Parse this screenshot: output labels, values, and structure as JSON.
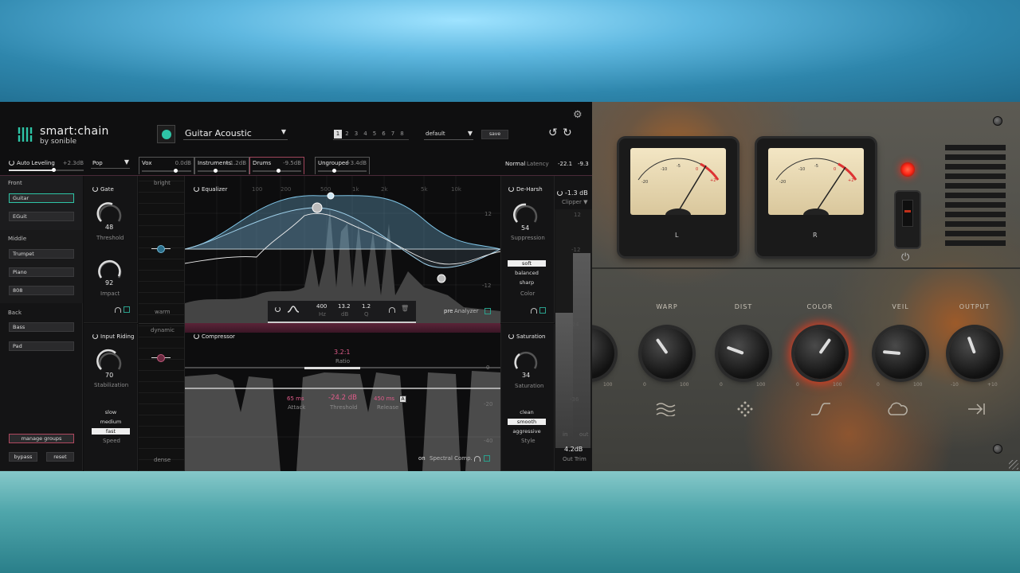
{
  "app": {
    "brand": "smart:chain",
    "byline": "by sonible"
  },
  "preset": {
    "name": "Guitar Acoustic",
    "slots": [
      "1",
      "2",
      "3",
      "4",
      "5",
      "6",
      "7",
      "8"
    ],
    "active_slot": "1",
    "bank": "default",
    "save_label": "save"
  },
  "topbar": {
    "auto_leveling_label": "Auto Leveling",
    "auto_leveling_value": "+2.3dB",
    "genre": "Pop",
    "groups": [
      {
        "name": "Vox",
        "value": "0.0dB"
      },
      {
        "name": "Instruments",
        "value": "+1.2dB"
      },
      {
        "name": "Drums",
        "value": "-9.5dB"
      },
      {
        "name": "Ungrouped",
        "value": "+3.4dB"
      }
    ],
    "mode": "Normal",
    "latency_label": "Latency",
    "meter_left": "-22.1",
    "meter_right": "-9.3"
  },
  "sidebar": {
    "front_label": "Front",
    "front_items": [
      "Guitar",
      "EGuit"
    ],
    "middle_label": "Middle",
    "middle_items": [
      "Trumpet",
      "Piano",
      "808"
    ],
    "back_label": "Back",
    "back_items": [
      "Bass",
      "Pad"
    ],
    "manage_label": "manage groups",
    "bypass_label": "bypass",
    "reset_label": "reset"
  },
  "gate": {
    "title": "Gate",
    "threshold_value": "48",
    "threshold_label": "Threshold",
    "impact_value": "92",
    "impact_label": "Impact"
  },
  "tilt": {
    "bright": "bright",
    "warm": "warm",
    "dynamic": "dynamic",
    "dense": "dense"
  },
  "eq": {
    "title": "Equalizer",
    "freq_labels": [
      "100",
      "200",
      "500",
      "1k",
      "2k",
      "5k",
      "10k"
    ],
    "db_labels": [
      "12",
      "",
      "-12"
    ],
    "hz_value": "400",
    "hz_unit": "Hz",
    "db_value": "13.2",
    "db_unit": "dB",
    "q_value": "1.2",
    "q_unit": "Q",
    "pre_label": "pre",
    "analyzer_label": "Analyzer"
  },
  "input_riding": {
    "title": "Input Riding",
    "value": "70",
    "label": "Stabilization",
    "speeds": [
      "slow",
      "medium",
      "fast"
    ],
    "active_speed": "fast",
    "speed_label": "Speed"
  },
  "compressor": {
    "title": "Compressor",
    "ratio_value": "3.2:1",
    "ratio_label": "Ratio",
    "attack_value": "65 ms",
    "attack_label": "Attack",
    "threshold_value": "-24.2 dB",
    "threshold_label": "Threshold",
    "release_value": "450 ms",
    "release_label": "Release",
    "release_mode": "A",
    "db_labels": [
      "0",
      "-20",
      "-40"
    ],
    "on_label": "on",
    "spectral_label": "Spectral Comp."
  },
  "deharsh": {
    "title": "De-Harsh",
    "value": "54",
    "label": "Suppression",
    "colors": [
      "soft",
      "balanced",
      "sharp"
    ],
    "active_color": "soft",
    "color_label": "Color"
  },
  "saturation": {
    "title": "Saturation",
    "value": "34",
    "label": "Saturation",
    "styles": [
      "clean",
      "smooth",
      "aggressive"
    ],
    "active_style": "smooth",
    "style_label": "Style"
  },
  "output": {
    "clipper_value": "-1.3 dB",
    "clipper_label": "Clipper",
    "scale": [
      "12",
      "-12",
      "-24",
      "-36"
    ],
    "in_label": "in",
    "out_label": "out",
    "trim_value": "4.2dB",
    "trim_label": "Out Trim"
  },
  "amp": {
    "knobs": [
      {
        "label": "WARP",
        "min": "0",
        "max": "100"
      },
      {
        "label": "DIST",
        "min": "0",
        "max": "100"
      },
      {
        "label": "COLOR",
        "min": "0",
        "max": "100"
      },
      {
        "label": "VEIL",
        "min": "0",
        "max": "100"
      },
      {
        "label": "OUTPUT",
        "min": "-10",
        "max": "+10"
      }
    ],
    "partial_knob": {
      "max": "100"
    },
    "meter_labels": [
      "-20",
      "-10",
      "-5",
      "0",
      "+2"
    ],
    "meter_l": "L",
    "meter_r": "R"
  },
  "colors": {
    "accent": "#2ec4a6",
    "pink": "#e05c8a",
    "eq_blue": "#7fc4e6",
    "amp_led": "#ff2a1a"
  }
}
